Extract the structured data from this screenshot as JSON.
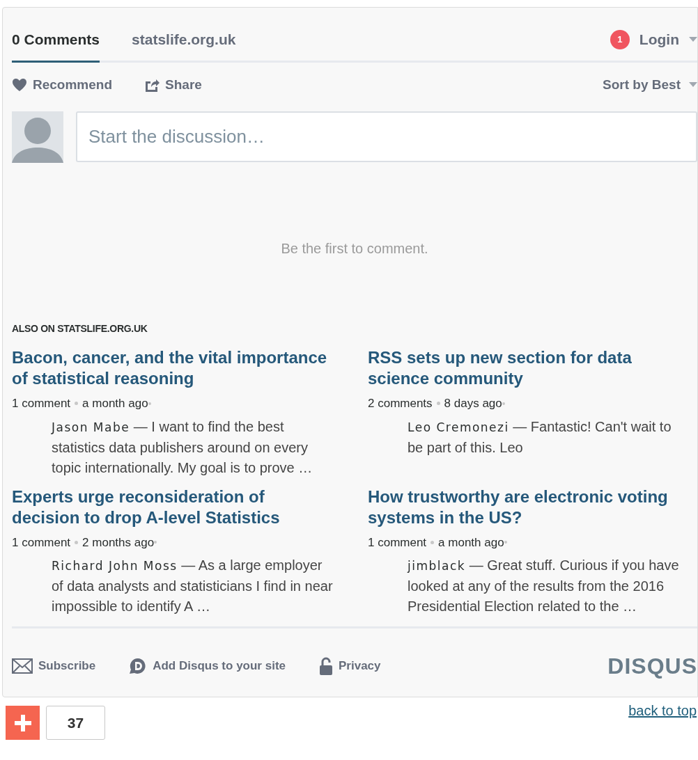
{
  "tabs": [
    {
      "label": "0 Comments",
      "selected": true
    },
    {
      "label": "statslife.org.uk",
      "selected": false
    }
  ],
  "notification_count": "1",
  "login": "Login",
  "actions": [
    {
      "kind": "recommend",
      "label": "Recommend"
    },
    {
      "kind": "share",
      "label": "Share"
    }
  ],
  "sort": "Sort by Best",
  "composer": {
    "placeholder": "Start the discussion…"
  },
  "empty_message": "Be the first to comment.",
  "also_on": {
    "label": "ALSO ON STATSLIFE.ORG.UK",
    "items": [
      {
        "title": "Bacon, cancer, and the vital importance of statistical reasoning",
        "comments": "1 comment",
        "age": "a month ago",
        "author": "Jason Mabe",
        "excerpt": "— I want to find the best statistics data publishers around on every topic internationally. My goal is to prove …"
      },
      {
        "title": "RSS sets up new section for data science community",
        "comments": "2 comments",
        "age": "8 days ago",
        "author": "Leo Cremonezi",
        "excerpt": "— Fantastic! Can't wait to be part of this. Leo"
      },
      {
        "title": "Experts urge reconsideration of decision to drop A-level Statistics",
        "comments": "1 comment",
        "age": "2 months ago",
        "author": "Richard John Moss",
        "excerpt": "— As a large employer of data analysts and statisticians I find in near impossible to identify A …"
      },
      {
        "title": "How trustworthy are electronic voting systems in the US?",
        "comments": "1 comment",
        "age": "a month ago",
        "author": "jimblack",
        "excerpt": "— Great stuff. Curious if you have looked at any of the results from the 2016 Presidential Election related to the …"
      }
    ]
  },
  "footer": {
    "links": [
      {
        "kind": "subscribe",
        "label": "Subscribe"
      },
      {
        "kind": "add",
        "label": "Add Disqus to your site"
      },
      {
        "kind": "privacy",
        "label": "Privacy"
      }
    ],
    "logo": "DISQUS"
  },
  "share_count": "37",
  "back_to_top": "back to top"
}
